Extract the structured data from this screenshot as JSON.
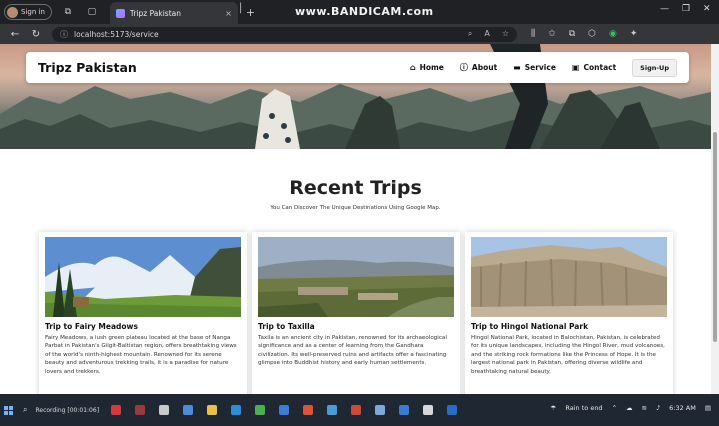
{
  "browser": {
    "profile_label": "Sign in",
    "tab_title": "Tripz Pakistan",
    "tab_close": "×",
    "new_tab": "+",
    "url": "localhost:5173/service",
    "watermark": "www.BANDICAM.com"
  },
  "navbar": {
    "brand": "Tripz Pakistan",
    "items": [
      {
        "label": "Home",
        "icon": "home-icon"
      },
      {
        "label": "About",
        "icon": "info-icon"
      },
      {
        "label": "Service",
        "icon": "service-icon"
      },
      {
        "label": "Contact",
        "icon": "contact-icon"
      }
    ],
    "signup": "Sign-Up"
  },
  "section": {
    "title": "Recent Trips",
    "subtitle": "You Can Discover The Unique Destinations Using Google Map."
  },
  "cards": [
    {
      "title": "Trip to Fairy Meadows",
      "text": "Fairy Meadows, a lush green plateau located at the base of Nanga Parbat in Pakistan's Gilgit-Baltistan region, offers breathtaking views of the world's ninth-highest mountain. Renowned for its serene beauty and adventurous trekking trails, it is a paradise for nature lovers and trekkers."
    },
    {
      "title": "Trip to Taxilla",
      "text": "Taxila is an ancient city in Pakistan, renowned for its archaeological significance and as a center of learning from the Gandhara civilization. Its well-preserved ruins and artifacts offer a fascinating glimpse into Buddhist history and early human settlements."
    },
    {
      "title": "Trip to Hingol National Park",
      "text": "Hingol National Park, located in Balochistan, Pakistan, is celebrated for its unique landscapes, including the Hingol River, mud volcanoes, and the striking rock formations like the Princess of Hope. It is the largest national park in Pakistan, offering diverse wildlife and breathtaking natural beauty."
    }
  ],
  "taskbar": {
    "task_label": "Recording [00:01:06]",
    "weather": "Rain to end",
    "time": "6:32 AM"
  }
}
